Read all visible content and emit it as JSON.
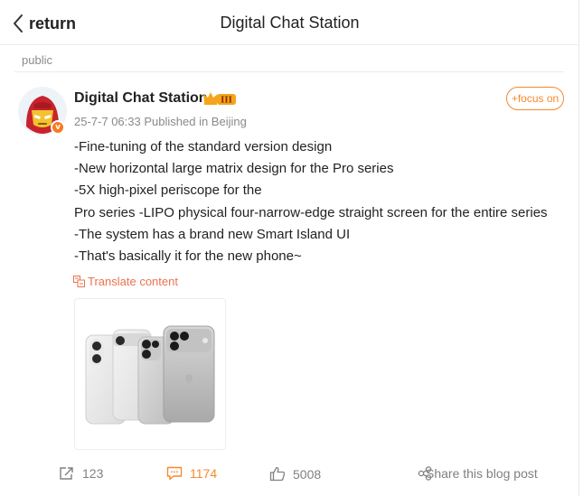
{
  "header": {
    "back_label": "return",
    "title": "Digital Chat Station"
  },
  "post": {
    "visibility": "public",
    "author": "Digital Chat Station",
    "badge_level": "III",
    "verified_mark": "v",
    "timestamp": "25-7-7 06:33",
    "location": "Published in Beijing",
    "follow_label": "+focus on",
    "lines": [
      "-Fine-tuning of the standard version design",
      "-New horizontal large matrix design for the Pro series",
      "-5X high-pixel periscope for the",
      "Pro series -LIPO physical four-narrow-edge straight screen for the entire series",
      "-The system has a brand new Smart Island UI",
      "-That's basically it for the new phone~"
    ],
    "translate_label": "Translate content",
    "accent_color": "#f58a2c"
  },
  "actions": {
    "repost_count": "123",
    "comment_count": "1174",
    "like_count": "5008",
    "share_label": "Share this blog post"
  }
}
